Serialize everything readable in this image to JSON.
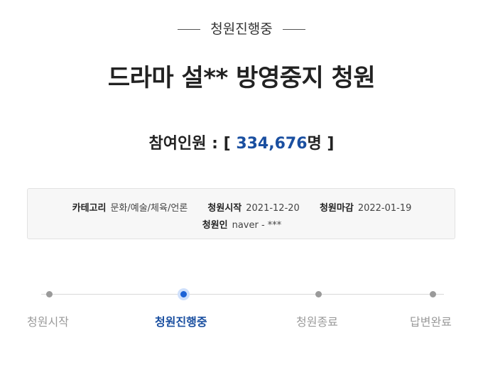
{
  "status": {
    "label": "청원진행중"
  },
  "petition": {
    "title": "드라마 설** 방영중지 청원"
  },
  "participants": {
    "prefix": "참여인원 : [ ",
    "count": "334,676",
    "suffix": "명 ]"
  },
  "info": {
    "category_key": "카테고리",
    "category_value": "문화/예술/체육/언론",
    "start_key": "청원시작",
    "start_value": "2021-12-20",
    "end_key": "청원마감",
    "end_value": "2022-01-19",
    "author_key": "청원인",
    "author_value": "naver - ***"
  },
  "progress": {
    "steps": [
      {
        "label": "청원시작"
      },
      {
        "label": "청원진행중"
      },
      {
        "label": "청원종료"
      },
      {
        "label": "답변완료"
      }
    ],
    "active_index": 1
  },
  "colors": {
    "accent": "#1a4fa0",
    "active_dot": "#1d63d6",
    "inactive": "#9a9a9a"
  }
}
